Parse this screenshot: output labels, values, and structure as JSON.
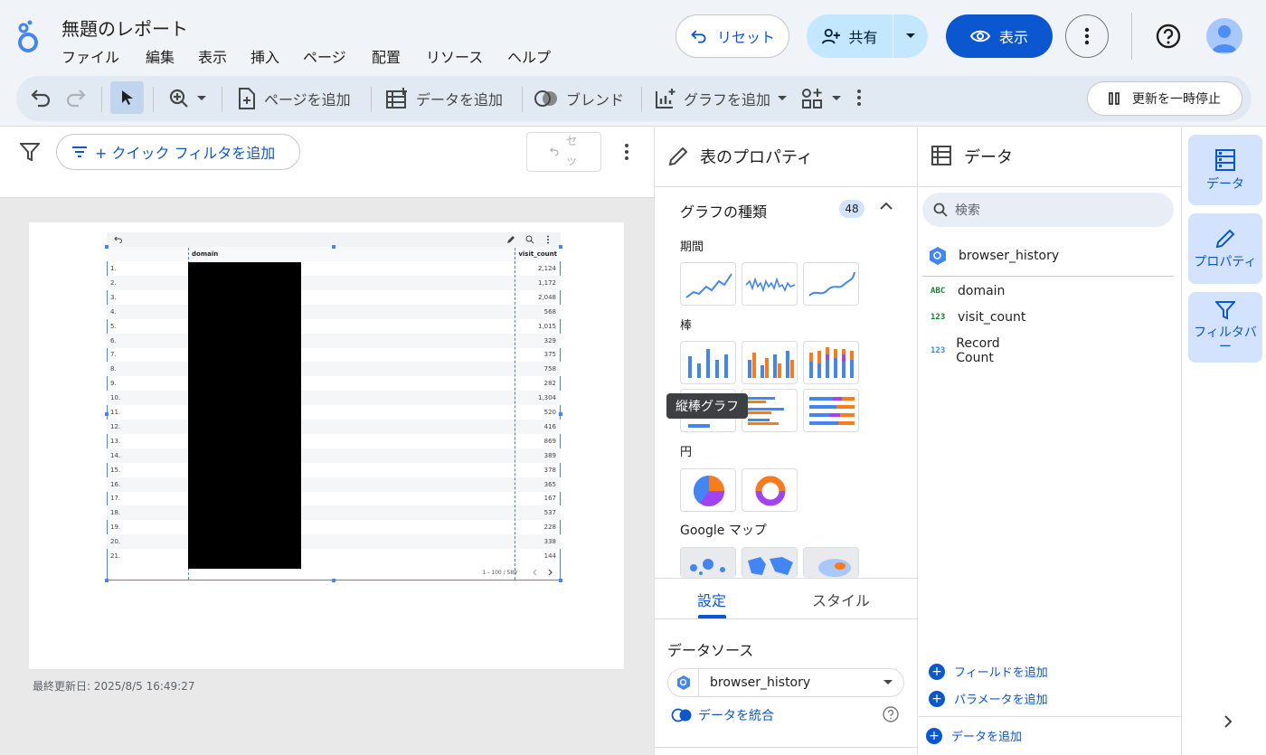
{
  "app": {
    "title": "無題のレポート",
    "menus": [
      "ファイル",
      "編集",
      "表示",
      "挿入",
      "ページ",
      "配置",
      "リソース",
      "ヘルプ"
    ]
  },
  "header": {
    "reset_label": "リセット",
    "share_label": "共有",
    "view_label": "表示"
  },
  "toolbar": {
    "add_page": "ページを追加",
    "add_data": "データを追加",
    "blend": "ブレンド",
    "add_chart": "グラフを追加",
    "pause": "更新を一時停止"
  },
  "filterbar": {
    "quick_filter": "+ クイック フィルタを追加",
    "reset_small": "セッ"
  },
  "canvas": {
    "last_updated": "最終更新日: 2025/8/5 16:49:27"
  },
  "table": {
    "headers": [
      "domain",
      "visit_count"
    ],
    "row_numbers": [
      "1.",
      "2.",
      "3.",
      "4.",
      "5.",
      "6.",
      "7.",
      "8.",
      "9.",
      "10.",
      "11.",
      "12.",
      "13.",
      "14.",
      "15.",
      "16.",
      "17.",
      "18.",
      "19.",
      "20.",
      "21."
    ],
    "visit_counts": [
      "2,124",
      "1,172",
      "2,048",
      "568",
      "1,015",
      "329",
      "375",
      "758",
      "282",
      "1,304",
      "520",
      "416",
      "869",
      "389",
      "378",
      "365",
      "167",
      "537",
      "228",
      "338",
      "144"
    ],
    "pagination": "1 - 100 / 589"
  },
  "properties": {
    "title": "表のプロパティ",
    "chart_type_label": "グラフの種類",
    "chart_type_count": "48",
    "categories": {
      "period": "期間",
      "bar": "棒",
      "pie": "円",
      "map": "Google マップ"
    },
    "tooltip": "縦棒グラフ",
    "tabs": {
      "setup": "設定",
      "style": "スタイル"
    },
    "datasource_label": "データソース",
    "datasource_value": "browser_history",
    "blend_label": "データを統合"
  },
  "data_panel": {
    "title": "データ",
    "search_placeholder": "検索",
    "source": "browser_history",
    "fields": [
      {
        "type": "ABC",
        "name": "domain",
        "color": "#188038"
      },
      {
        "type": "123",
        "name": "visit_count",
        "color": "#188038"
      },
      {
        "type": "123",
        "name": "Record Count",
        "color": "#4285f4"
      }
    ],
    "add_field": "フィールドを追加",
    "add_param": "パラメータを追加",
    "add_data": "データを追加"
  },
  "rail": {
    "data": "データ",
    "properties": "プロパティ",
    "filterbar": "フィルタバー"
  },
  "colors": {
    "accent": "#0b57d0",
    "bar_blue": "#4285f4",
    "bar_orange": "#fa7b17",
    "pie_purple": "#a142f4"
  }
}
